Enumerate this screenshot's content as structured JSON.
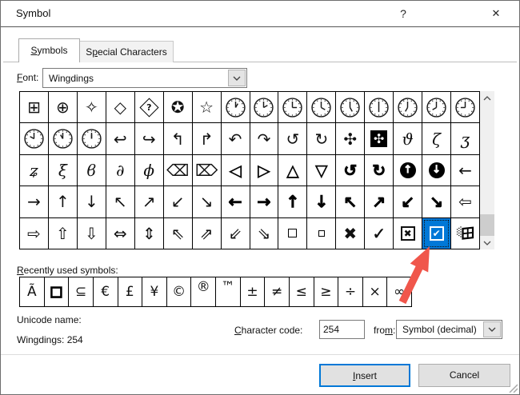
{
  "window": {
    "title": "Symbol",
    "help_glyph": "?",
    "close_glyph": "✕"
  },
  "tabs": [
    {
      "text": "Symbols",
      "accel": "S",
      "active": true
    },
    {
      "text": "Special Characters",
      "accel": "p",
      "active": false
    }
  ],
  "font_row": {
    "label": {
      "text": "Font:",
      "accel": "F"
    },
    "value": "Wingdings"
  },
  "grid": {
    "columns": 16,
    "rows": 5,
    "selected_character_code": 254,
    "cells": [
      "⊞",
      "⊕",
      "✧",
      "◇",
      {
        "d": "?"
      },
      "✪",
      "☆",
      {
        "clock": 1
      },
      {
        "clock": 2
      },
      {
        "clock": 3
      },
      {
        "clock": 4
      },
      {
        "clock": 5
      },
      {
        "clock": 6
      },
      {
        "clock": 7
      },
      {
        "clock": 8
      },
      {
        "clock": 9
      },
      {
        "clock": 10
      },
      {
        "clock": 11
      },
      {
        "clock": 12
      },
      "↩",
      "↪",
      "↰",
      "↱",
      "↶",
      "↷",
      "↺",
      "↻",
      "✣",
      {
        "inv": "✣"
      },
      {
        "g": "ϑ",
        "cls": "vine"
      },
      {
        "g": "ζ",
        "cls": "vine"
      },
      {
        "g": "ʒ",
        "cls": "vine"
      },
      {
        "g": "ʑ",
        "cls": "vine"
      },
      {
        "g": "ξ",
        "cls": "vine"
      },
      {
        "g": "ϐ",
        "cls": "vine"
      },
      {
        "g": "∂",
        "cls": "vine"
      },
      {
        "g": "ϕ",
        "cls": "vine"
      },
      "⌫",
      "⌦",
      {
        "g": "◁",
        "cls": "ah"
      },
      {
        "g": "▷",
        "cls": "ah"
      },
      {
        "g": "△",
        "cls": "ah"
      },
      {
        "g": "▽",
        "cls": "ah"
      },
      {
        "g": "↺",
        "cls": "hv"
      },
      {
        "g": "↻",
        "cls": "hv"
      },
      {
        "circ": "↑"
      },
      {
        "circ": "↓"
      },
      "←",
      "→",
      "↑",
      "↓",
      "↖",
      "↗",
      "↙",
      "↘",
      {
        "g": "←",
        "cls": "hv"
      },
      {
        "g": "→",
        "cls": "hv"
      },
      {
        "g": "↑",
        "cls": "hv"
      },
      {
        "g": "↓",
        "cls": "hv"
      },
      {
        "g": "↖",
        "cls": "hv"
      },
      {
        "g": "↗",
        "cls": "hv"
      },
      {
        "g": "↙",
        "cls": "hv"
      },
      {
        "g": "↘",
        "cls": "hv"
      },
      "⇦",
      "⇨",
      "⇧",
      "⇩",
      "⇔",
      "⇕",
      "⇖",
      "⇗",
      "⇙",
      "⇘",
      {
        "sqr": 11
      },
      {
        "sqr": 8
      },
      {
        "g": "✖",
        "cls": "xx"
      },
      {
        "g": "✓",
        "cls": "ck"
      },
      {
        "box": "✖"
      },
      {
        "box": "✔",
        "sel": true
      },
      {
        "win": true
      }
    ]
  },
  "recent": {
    "label": {
      "text": "Recently used symbols:",
      "accel": "R"
    },
    "cells": [
      {
        "g": "Ã",
        "cls": "lg"
      },
      {
        "g": "□",
        "cls": "bsq"
      },
      "⊆",
      "€",
      "£",
      "¥",
      "©",
      {
        "g": "®",
        "cls": "sup"
      },
      {
        "g": "™",
        "cls": "sup"
      },
      "±",
      "≠",
      "≤",
      "≥",
      "÷",
      "×",
      "∞"
    ]
  },
  "info": {
    "unicode_name_label": "Unicode name:",
    "unicode_name_value": "Wingdings: 254"
  },
  "char_code": {
    "label": {
      "text": "Character code:",
      "accel": "C"
    },
    "value": "254",
    "from_label": {
      "text": "from:",
      "accel": "m"
    },
    "from_value": "Symbol (decimal)"
  },
  "buttons": {
    "insert": {
      "text": "Insert",
      "accel": "I"
    },
    "cancel": {
      "text": "Cancel"
    }
  },
  "colors": {
    "selection_blue": "#0078d7",
    "insert_button_border": "#0078d7",
    "annotation_arrow_red": "#f0564b"
  }
}
